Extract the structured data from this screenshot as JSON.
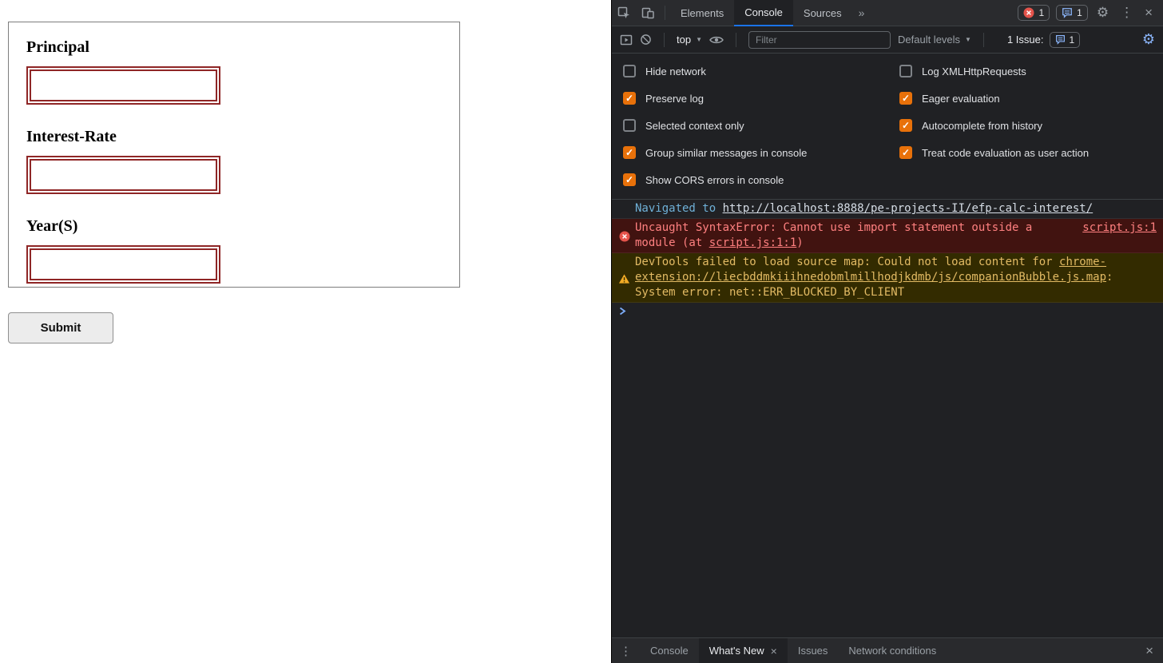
{
  "page": {
    "fields": [
      {
        "label": "Principal",
        "value": ""
      },
      {
        "label": "Interest-Rate",
        "value": ""
      },
      {
        "label": "Year(S)",
        "value": ""
      }
    ],
    "submit_label": "Submit"
  },
  "devtools": {
    "colors": {
      "accent_blue": "#1a73e8",
      "checkbox_orange": "#e8710a",
      "error_red": "#ff8080",
      "error_bg": "#411310",
      "warning_yellow": "#e2ba64",
      "warning_bg": "#332b00"
    },
    "icons": {
      "gear": "⚙",
      "kebab": "⋮",
      "close": "×",
      "more_tabs": "»",
      "caret": "▼"
    },
    "tabs": {
      "elements": "Elements",
      "console": "Console",
      "sources": "Sources"
    },
    "badges": {
      "error_count": "1",
      "message_count": "1"
    },
    "toolbar": {
      "context": "top",
      "filter_placeholder": "Filter",
      "levels": "Default levels",
      "issues_label": "1 Issue:",
      "issues_count": "1"
    },
    "settings_left": [
      {
        "label": "Hide network",
        "checked": false
      },
      {
        "label": "Preserve log",
        "checked": true
      },
      {
        "label": "Selected context only",
        "checked": false
      },
      {
        "label": "Group similar messages in console",
        "checked": true
      },
      {
        "label": "Show CORS errors in console",
        "checked": true
      }
    ],
    "settings_right": [
      {
        "label": "Log XMLHttpRequests",
        "checked": false
      },
      {
        "label": "Eager evaluation",
        "checked": true
      },
      {
        "label": "Autocomplete from history",
        "checked": true
      },
      {
        "label": "Treat code evaluation as user action",
        "checked": true
      }
    ],
    "console": {
      "nav_prefix": "Navigated to ",
      "nav_url": "http://localhost:8888/pe-projects-II/efp-calc-interest/",
      "error_pre": "Uncaught SyntaxError: Cannot use import statement outside a module (at ",
      "error_link": "script.js:1:1",
      "error_post": ")",
      "error_source": "script.js:1",
      "warn_pre": "DevTools failed to load source map: Could not load content for ",
      "warn_link": "chrome-extension://liecbddmkiiihnedobmlmillhodjkdmb/js/companionBubble.js.map",
      "warn_post": ": System error: net::ERR_BLOCKED_BY_CLIENT"
    },
    "drawer": {
      "tabs": [
        "Console",
        "What's New",
        "Issues",
        "Network conditions"
      ]
    }
  }
}
